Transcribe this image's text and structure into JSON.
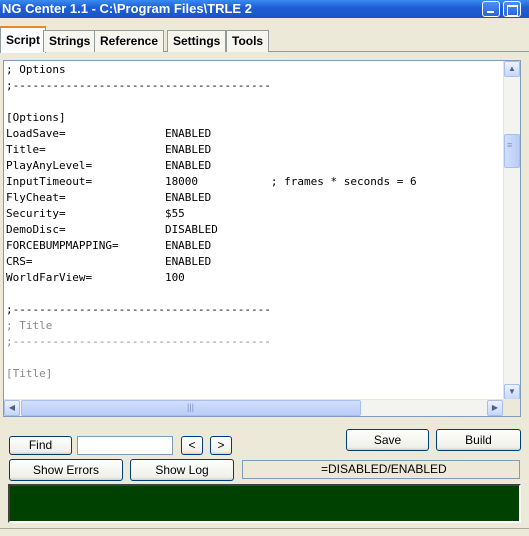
{
  "window": {
    "title": "NG Center 1.1 - C:\\Program Files\\TRLE 2"
  },
  "tabs": [
    {
      "label": "Script"
    },
    {
      "label": "Strings"
    },
    {
      "label": "Reference"
    },
    {
      "label": "Settings"
    },
    {
      "label": "Tools"
    }
  ],
  "active_tab": "Script",
  "editor": {
    "lines": [
      "; Options",
      ";---------------------------------------",
      "",
      "[Options]",
      "LoadSave=               ENABLED",
      "Title=                  ENABLED",
      "PlayAnyLevel=           ENABLED",
      "InputTimeout=           18000           ; frames * seconds = 6",
      "FlyCheat=               ENABLED",
      "Security=               $55",
      "DemoDisc=               DISABLED",
      "FORCEBUMPMAPPING=       ENABLED",
      "CRS=                    ENABLED",
      "WorldFarView=           100",
      "",
      ";---------------------------------------",
      "; Title",
      ";---------------------------------------",
      "",
      "[Title]",
      "",
      ""
    ],
    "gray_from_line": 16
  },
  "toolbar": {
    "find_label": "Find",
    "find_value": "",
    "prev_label": "<",
    "next_label": ">",
    "save_label": "Save",
    "build_label": "Build",
    "show_errors_label": "Show Errors",
    "show_log_label": "Show Log",
    "status_text": "=DISABLED/ENABLED"
  },
  "scroll_icons": {
    "up": "up-arrow-icon",
    "down": "down-arrow-icon",
    "left": "left-arrow-icon",
    "right": "right-arrow-icon"
  },
  "colors": {
    "console_bg": "#004000",
    "title_bar": "#1f5fd6",
    "active_tab_accent": "#e68b2c"
  }
}
